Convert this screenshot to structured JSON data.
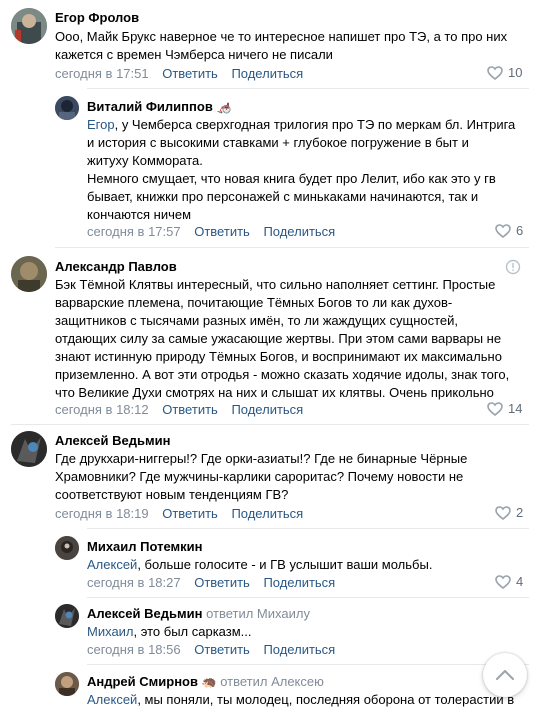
{
  "actions": {
    "reply": "Ответить",
    "share": "Поделиться"
  },
  "comments": [
    {
      "author": "Егор Фролов",
      "lines": [
        "Ооо, Майк Брукс наверное че то интересное напишет про ТЭ, а то про них",
        "кажется с времен Чэмберса ничего не писали"
      ],
      "time": "сегодня в 17:51",
      "likes": "10"
    },
    {
      "author": "Виталий Филиппов",
      "badge": "🦽",
      "mention": "Егор",
      "lines": [
        ", у Чемберса сверхгодная трилогия про ТЭ по меркам бл. Интрига",
        "и история с высокими ставками + глубокое погружение в быт и",
        "житуху Коммората.",
        "Немного смущает, что новая книга будет про Лелит, ибо как это у гв",
        "бывает, книжки про персонажей с минькаками начинаются, так и",
        "кончаются ничем"
      ],
      "time": "сегодня в 17:57",
      "likes": "6"
    },
    {
      "author": "Александр Павлов",
      "lines": [
        "Бэк Тёмной Клятвы интересный, что сильно наполняет сеттинг. Простые",
        "варварские племена, почитающие Тёмных Богов то ли как духов-",
        "защитников с тысячами разных имён, то ли жаждущих сущностей,",
        "отдающих силу за самые ужасающие жертвы. При этом сами варвары не",
        "знают истинную природу Тёмных Богов, и воспринимают их максимально",
        "приземленно. А вот эти отродья - можно сказать ходячие идолы, знак того,",
        "что Великие Духи смотрях на них и слышат их клятвы. Очень прикольно"
      ],
      "time": "сегодня в 18:12",
      "likes": "14"
    },
    {
      "author": "Алексей Ведьмин",
      "lines": [
        "Где друкхари-ниггеры!? Где орки-азиаты!? Где не бинарные Чёрные",
        "Храмовники? Где мужчины-карлики сароритас? Почему новости не",
        "соответствуют новым тенденциям ГВ?"
      ],
      "time": "сегодня в 18:19",
      "likes": "2"
    },
    {
      "author": "Михаил Потемкин",
      "mention": "Алексей",
      "lines": [
        ", больше голосите - и ГВ услышит ваши мольбы."
      ],
      "time": "сегодня в 18:27",
      "likes": "4"
    },
    {
      "author": "Алексей Ведьмин",
      "replied": "ответил Михаилу",
      "mention": "Михаил",
      "lines": [
        ", это был сарказм..."
      ],
      "time": "сегодня в 18:56"
    },
    {
      "author": "Андрей Смирнов",
      "badge": "🦔",
      "replied": "ответил Алексею",
      "mention": "Алексей",
      "lines": [
        ", мы поняли, ты молодец, последняя оборона от толерастии в"
      ]
    }
  ]
}
